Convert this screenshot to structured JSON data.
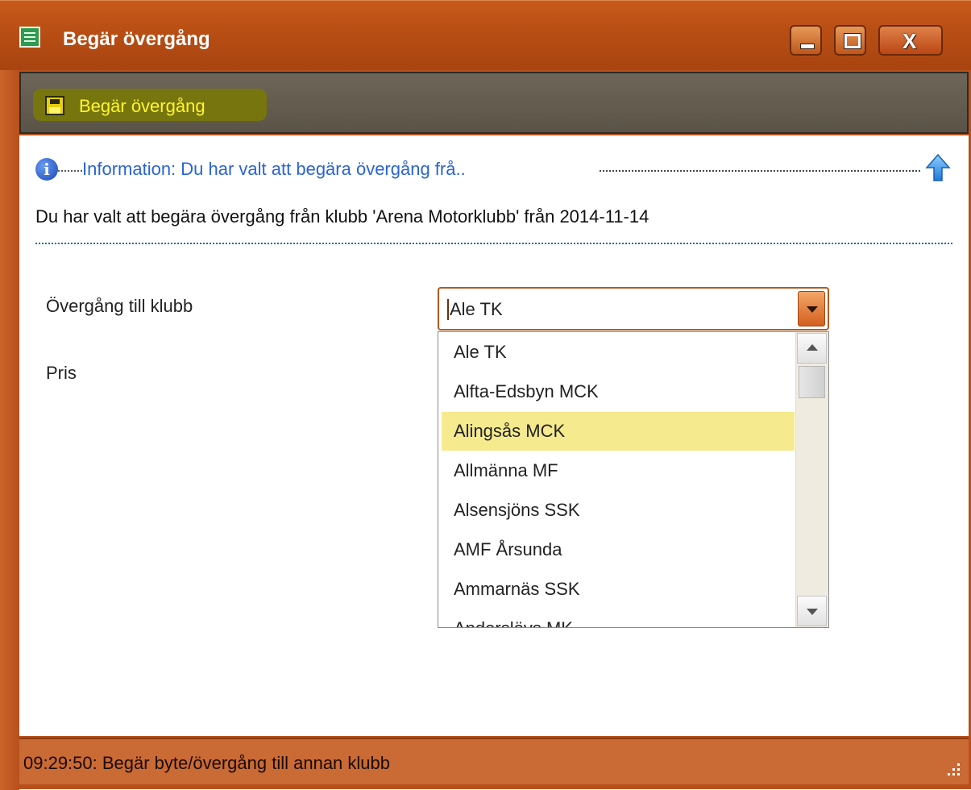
{
  "window": {
    "title": "Begär övergång",
    "icon": "form-window-icon",
    "controls": {
      "minimize": "minimize-icon",
      "maximize": "maximize-icon",
      "close_glyph": "X"
    }
  },
  "toolbar": {
    "save_label": "Begär övergång",
    "save_icon": "floppy-disk-icon"
  },
  "info": {
    "icon": "info-icon",
    "title": "Information: Du har valt att begära övergång frå..",
    "collapse_icon": "up-arrow-icon",
    "message": "Du har valt att begära övergång från klubb 'Arena Motorklubb' från 2014-11-14"
  },
  "form": {
    "club_label": "Övergång till klubb",
    "price_label": "Pris",
    "club_value": "Ale TK",
    "club_options": [
      "Ale TK",
      "Alfta-Edsbyn MCK",
      "Alingsås MCK",
      "Allmänna MF",
      "Alsensjöns SSK",
      "AMF Årsunda",
      "Ammarnäs SSK",
      "Anderslövs MK"
    ],
    "highlighted_option": "Alingsås MCK"
  },
  "status": {
    "text": "09:29:50: Begär byte/övergång till annan klubb"
  },
  "colors": {
    "titlebar": "#b84e14",
    "toolbar": "#6e6658",
    "toolbar_label": "#fff52e",
    "info_blue": "#2a63d6",
    "highlight": "#f6ea8e",
    "statusbar": "#ca6a34"
  }
}
